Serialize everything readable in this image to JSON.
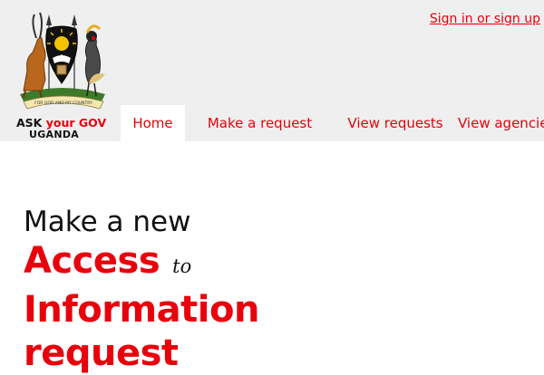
{
  "site": {
    "logo": {
      "motto": "FOR GOD AND MY COUNTRY",
      "line1_part1": "ASK",
      "line1_part2": "your",
      "line1_part3": "GOV",
      "line2": "UGANDA"
    },
    "signin_label": "Sign in or sign up"
  },
  "nav": {
    "items": [
      {
        "label": "Home",
        "active": true
      },
      {
        "label": "Make a request",
        "active": false
      },
      {
        "label": "View requests",
        "active": false
      },
      {
        "label": "View agencies",
        "active": false
      }
    ]
  },
  "hero": {
    "line1": "Make a new",
    "access": "Access",
    "to": "to",
    "information": "Information",
    "request": "request"
  },
  "colors": {
    "accent": "#e8000b",
    "header_bg": "#efefef",
    "text": "#111111"
  },
  "icons": [
    "uganda-coat-of-arms-icon"
  ]
}
